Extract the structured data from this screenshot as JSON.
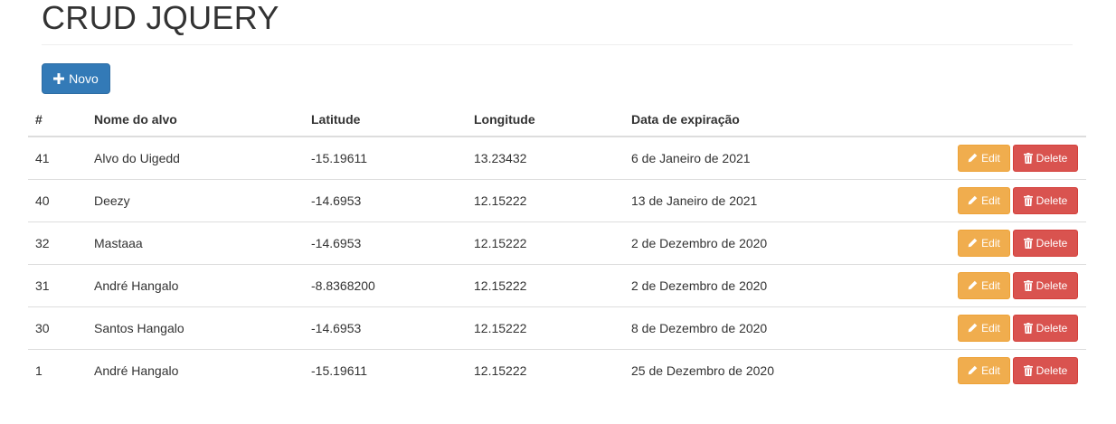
{
  "page": {
    "title": "CRUD JQUERY"
  },
  "toolbar": {
    "new_label": "Novo"
  },
  "table": {
    "headers": [
      "#",
      "Nome do alvo",
      "Latitude",
      "Longitude",
      "Data de expiração",
      ""
    ],
    "edit_label": "Edit",
    "delete_label": "Delete",
    "rows": [
      {
        "id": "41",
        "name": "Alvo do Uigedd",
        "latitude": "-15.19611",
        "longitude": "13.23432",
        "expiry": "6 de Janeiro de 2021"
      },
      {
        "id": "40",
        "name": "Deezy",
        "latitude": "-14.6953",
        "longitude": "12.15222",
        "expiry": "13 de Janeiro de 2021"
      },
      {
        "id": "32",
        "name": "Mastaaa",
        "latitude": "-14.6953",
        "longitude": "12.15222",
        "expiry": "2 de Dezembro de 2020"
      },
      {
        "id": "31",
        "name": "André Hangalo",
        "latitude": "-8.8368200",
        "longitude": "12.15222",
        "expiry": "2 de Dezembro de 2020"
      },
      {
        "id": "30",
        "name": "Santos Hangalo",
        "latitude": "-14.6953",
        "longitude": "12.15222",
        "expiry": "8 de Dezembro de 2020"
      },
      {
        "id": "1",
        "name": "André Hangalo",
        "latitude": "-15.19611",
        "longitude": "12.15222",
        "expiry": "25 de Dezembro de 2020"
      }
    ]
  },
  "colors": {
    "primary": "#337ab7",
    "warning": "#f0ad4e",
    "danger": "#d9534f"
  },
  "icons": {
    "new": "plus-icon",
    "edit": "pencil-icon",
    "delete": "trash-icon"
  }
}
